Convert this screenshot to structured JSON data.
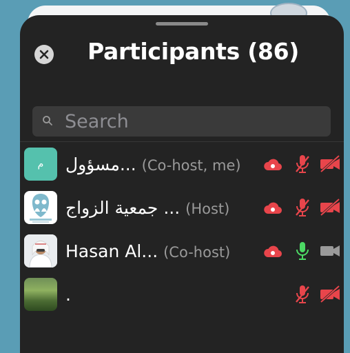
{
  "header": {
    "title": "Participants (86)"
  },
  "search": {
    "placeholder": "Search"
  },
  "participants": [
    {
      "name": "مسؤول...",
      "role": "(Co-host, me)",
      "avatar_text": "م"
    },
    {
      "name": "جمعية الزواج ...",
      "role": "(Host)"
    },
    {
      "name": "Hasan Al...",
      "role": "(Co-host)"
    },
    {
      "name": ".",
      "role": ""
    }
  ],
  "colors": {
    "panel": "#232323",
    "muted": "#e8454b",
    "unmuted": "#4cd964",
    "video_on": "#9a9a9a",
    "avatar_teal": "#55c1ad"
  }
}
